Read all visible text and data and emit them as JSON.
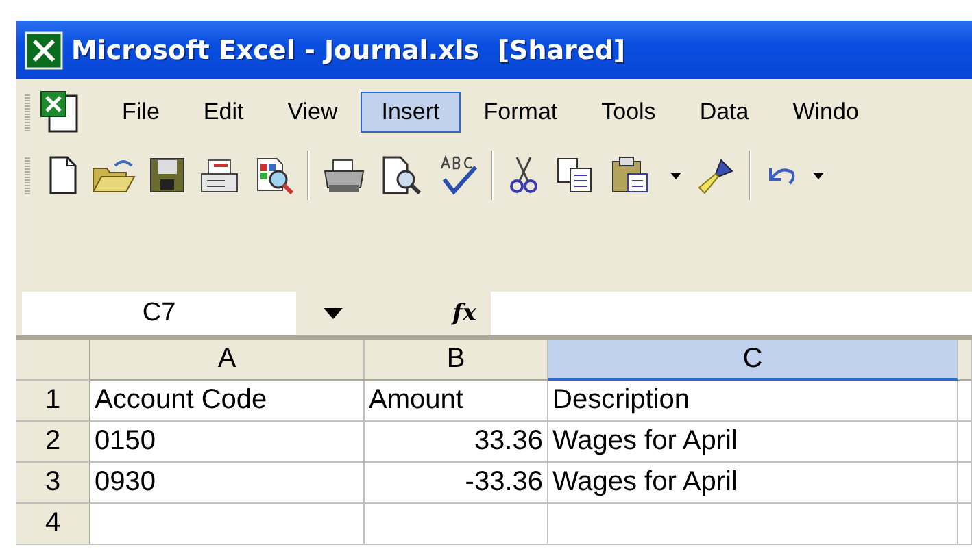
{
  "window": {
    "title": "Microsoft Excel - Journal.xls  [Shared]"
  },
  "menu": [
    {
      "label": "File",
      "selected": false
    },
    {
      "label": "Edit",
      "selected": false
    },
    {
      "label": "View",
      "selected": false
    },
    {
      "label": "Insert",
      "selected": true
    },
    {
      "label": "Format",
      "selected": false
    },
    {
      "label": "Tools",
      "selected": false
    },
    {
      "label": "Data",
      "selected": false
    },
    {
      "label": "Windo",
      "selected": false
    }
  ],
  "formula_bar": {
    "name_box": "C7",
    "fx": "fx"
  },
  "sheet": {
    "columns": [
      {
        "label": "A",
        "selected": false
      },
      {
        "label": "B",
        "selected": false
      },
      {
        "label": "C",
        "selected": true
      }
    ],
    "rows": [
      {
        "label": "1",
        "cells": [
          "Account Code",
          "Amount",
          "Description"
        ]
      },
      {
        "label": "2",
        "cells": [
          "0150",
          "33.36",
          "Wages for April"
        ]
      },
      {
        "label": "3",
        "cells": [
          "0930",
          "-33.36",
          "Wages for April"
        ]
      },
      {
        "label": "4",
        "cells": [
          "",
          "",
          ""
        ]
      }
    ]
  }
}
